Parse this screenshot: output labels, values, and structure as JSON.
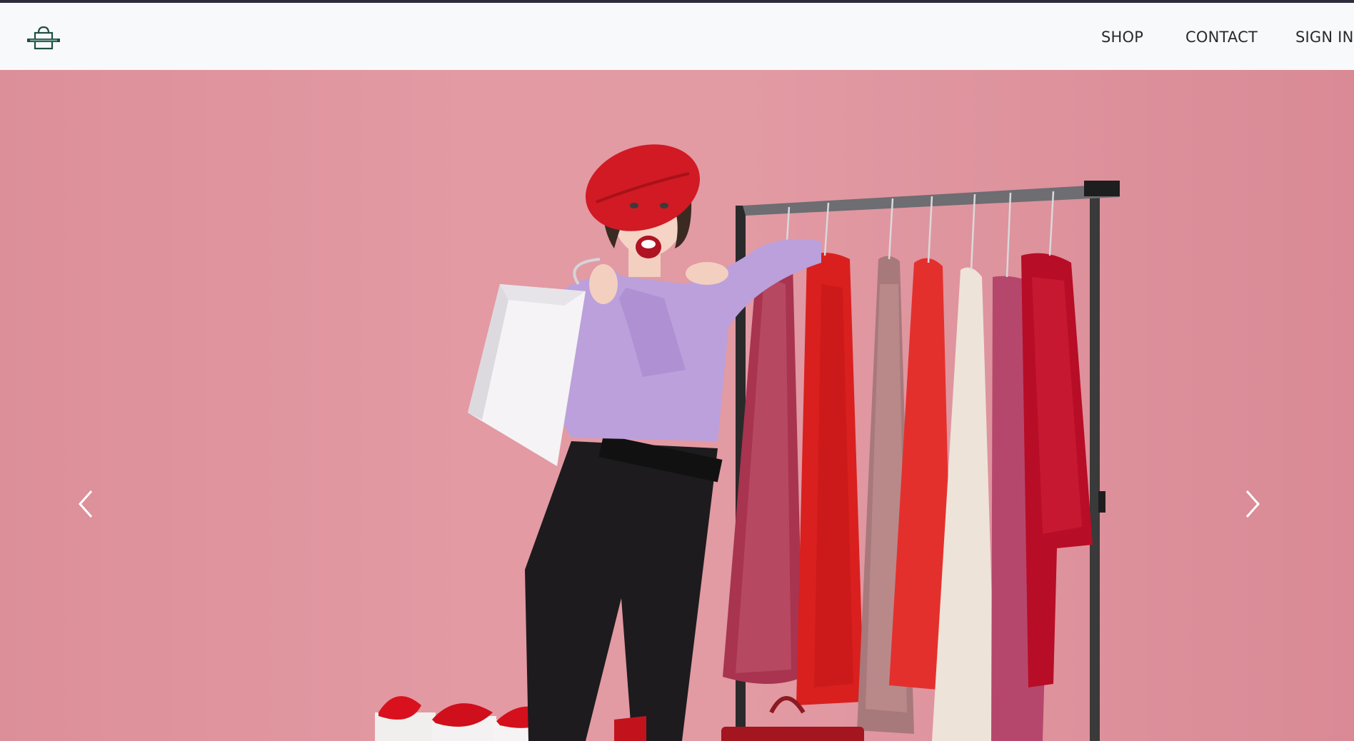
{
  "header": {
    "logo_icon": "shopping-bag-logo-icon",
    "nav": [
      {
        "label": "SHOP"
      },
      {
        "label": "CONTACT"
      },
      {
        "label": "SIGN IN"
      }
    ]
  },
  "hero": {
    "image": "woman-in-red-beret-with-shopping-bag-beside-clothing-rack",
    "prev_icon": "chevron-left-icon",
    "next_icon": "chevron-right-icon",
    "background_color": "#e39aa3"
  },
  "colors": {
    "nav_background": "#f8f9fa",
    "nav_text": "#2a2a2a",
    "logo": "#1f4f3f"
  }
}
